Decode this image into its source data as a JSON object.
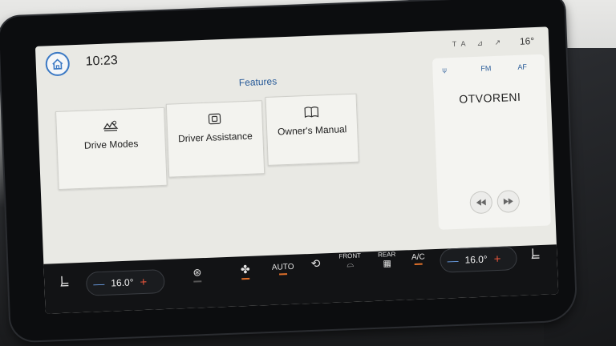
{
  "status": {
    "time": "10:23",
    "icons": [
      "TA",
      "signal-icon",
      "nav-icon"
    ],
    "ta_label": "TA",
    "temperature": "16°"
  },
  "features": {
    "title": "Features",
    "tiles": [
      {
        "label": "Drive Modes",
        "icon": "drive-modes-icon"
      },
      {
        "label": "Driver Assistance",
        "icon": "driver-assistance-icon"
      },
      {
        "label": "Owner's Manual",
        "icon": "owners-manual-icon"
      }
    ]
  },
  "radio": {
    "tabs": {
      "fm": "FM",
      "af": "AF"
    },
    "station": "OTVORENI",
    "controls": [
      "seek-back-icon",
      "seek-forward-icon"
    ]
  },
  "climate": {
    "driver_temp": "16.0°",
    "passenger_temp": "16.0°",
    "auto_label": "AUTO",
    "front_label": "FRONT",
    "rear_label": "REAR",
    "ac_label": "A/C",
    "accent_orange": "#e0702a",
    "minus_color": "#6b9fe6",
    "plus_color": "#e6553b"
  }
}
